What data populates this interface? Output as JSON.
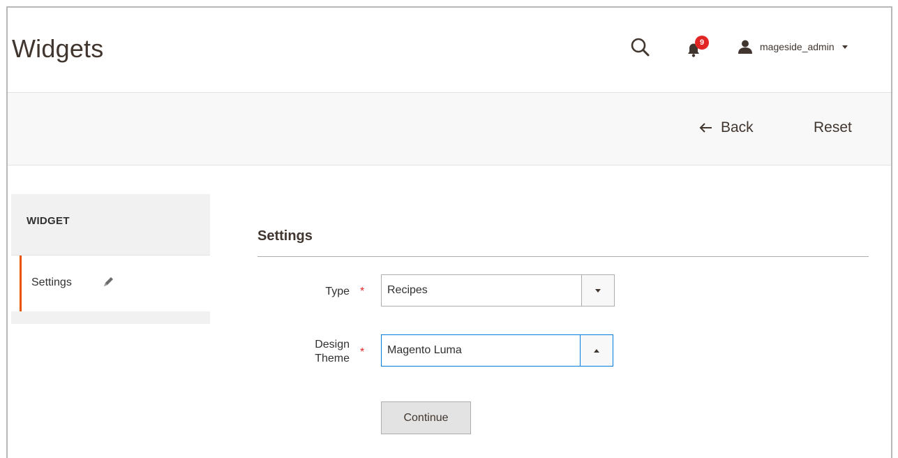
{
  "header": {
    "title": "Widgets",
    "notifications_count": "9",
    "account_name": "mageside_admin"
  },
  "actions": {
    "back_label": "Back",
    "reset_label": "Reset"
  },
  "sidebar": {
    "section_title": "WIDGET",
    "items": [
      {
        "label": "Settings",
        "active": true
      }
    ]
  },
  "form": {
    "fieldset_title": "Settings",
    "fields": [
      {
        "label_line1": "Type",
        "required": true,
        "value": "Recipes",
        "open": false
      },
      {
        "label_line1": "Design",
        "label_line2": "Theme",
        "required": true,
        "value": "Magento Luma",
        "open": true
      }
    ],
    "continue_label": "Continue"
  },
  "icons": {
    "search": "search-icon",
    "notifications": "bell-icon",
    "account": "user-icon",
    "back": "arrow-left-icon",
    "edit": "pencil-icon"
  },
  "colors": {
    "accent": "#eb5202",
    "badge": "#e22626",
    "required": "#e22626",
    "focus": "#007bdb"
  }
}
